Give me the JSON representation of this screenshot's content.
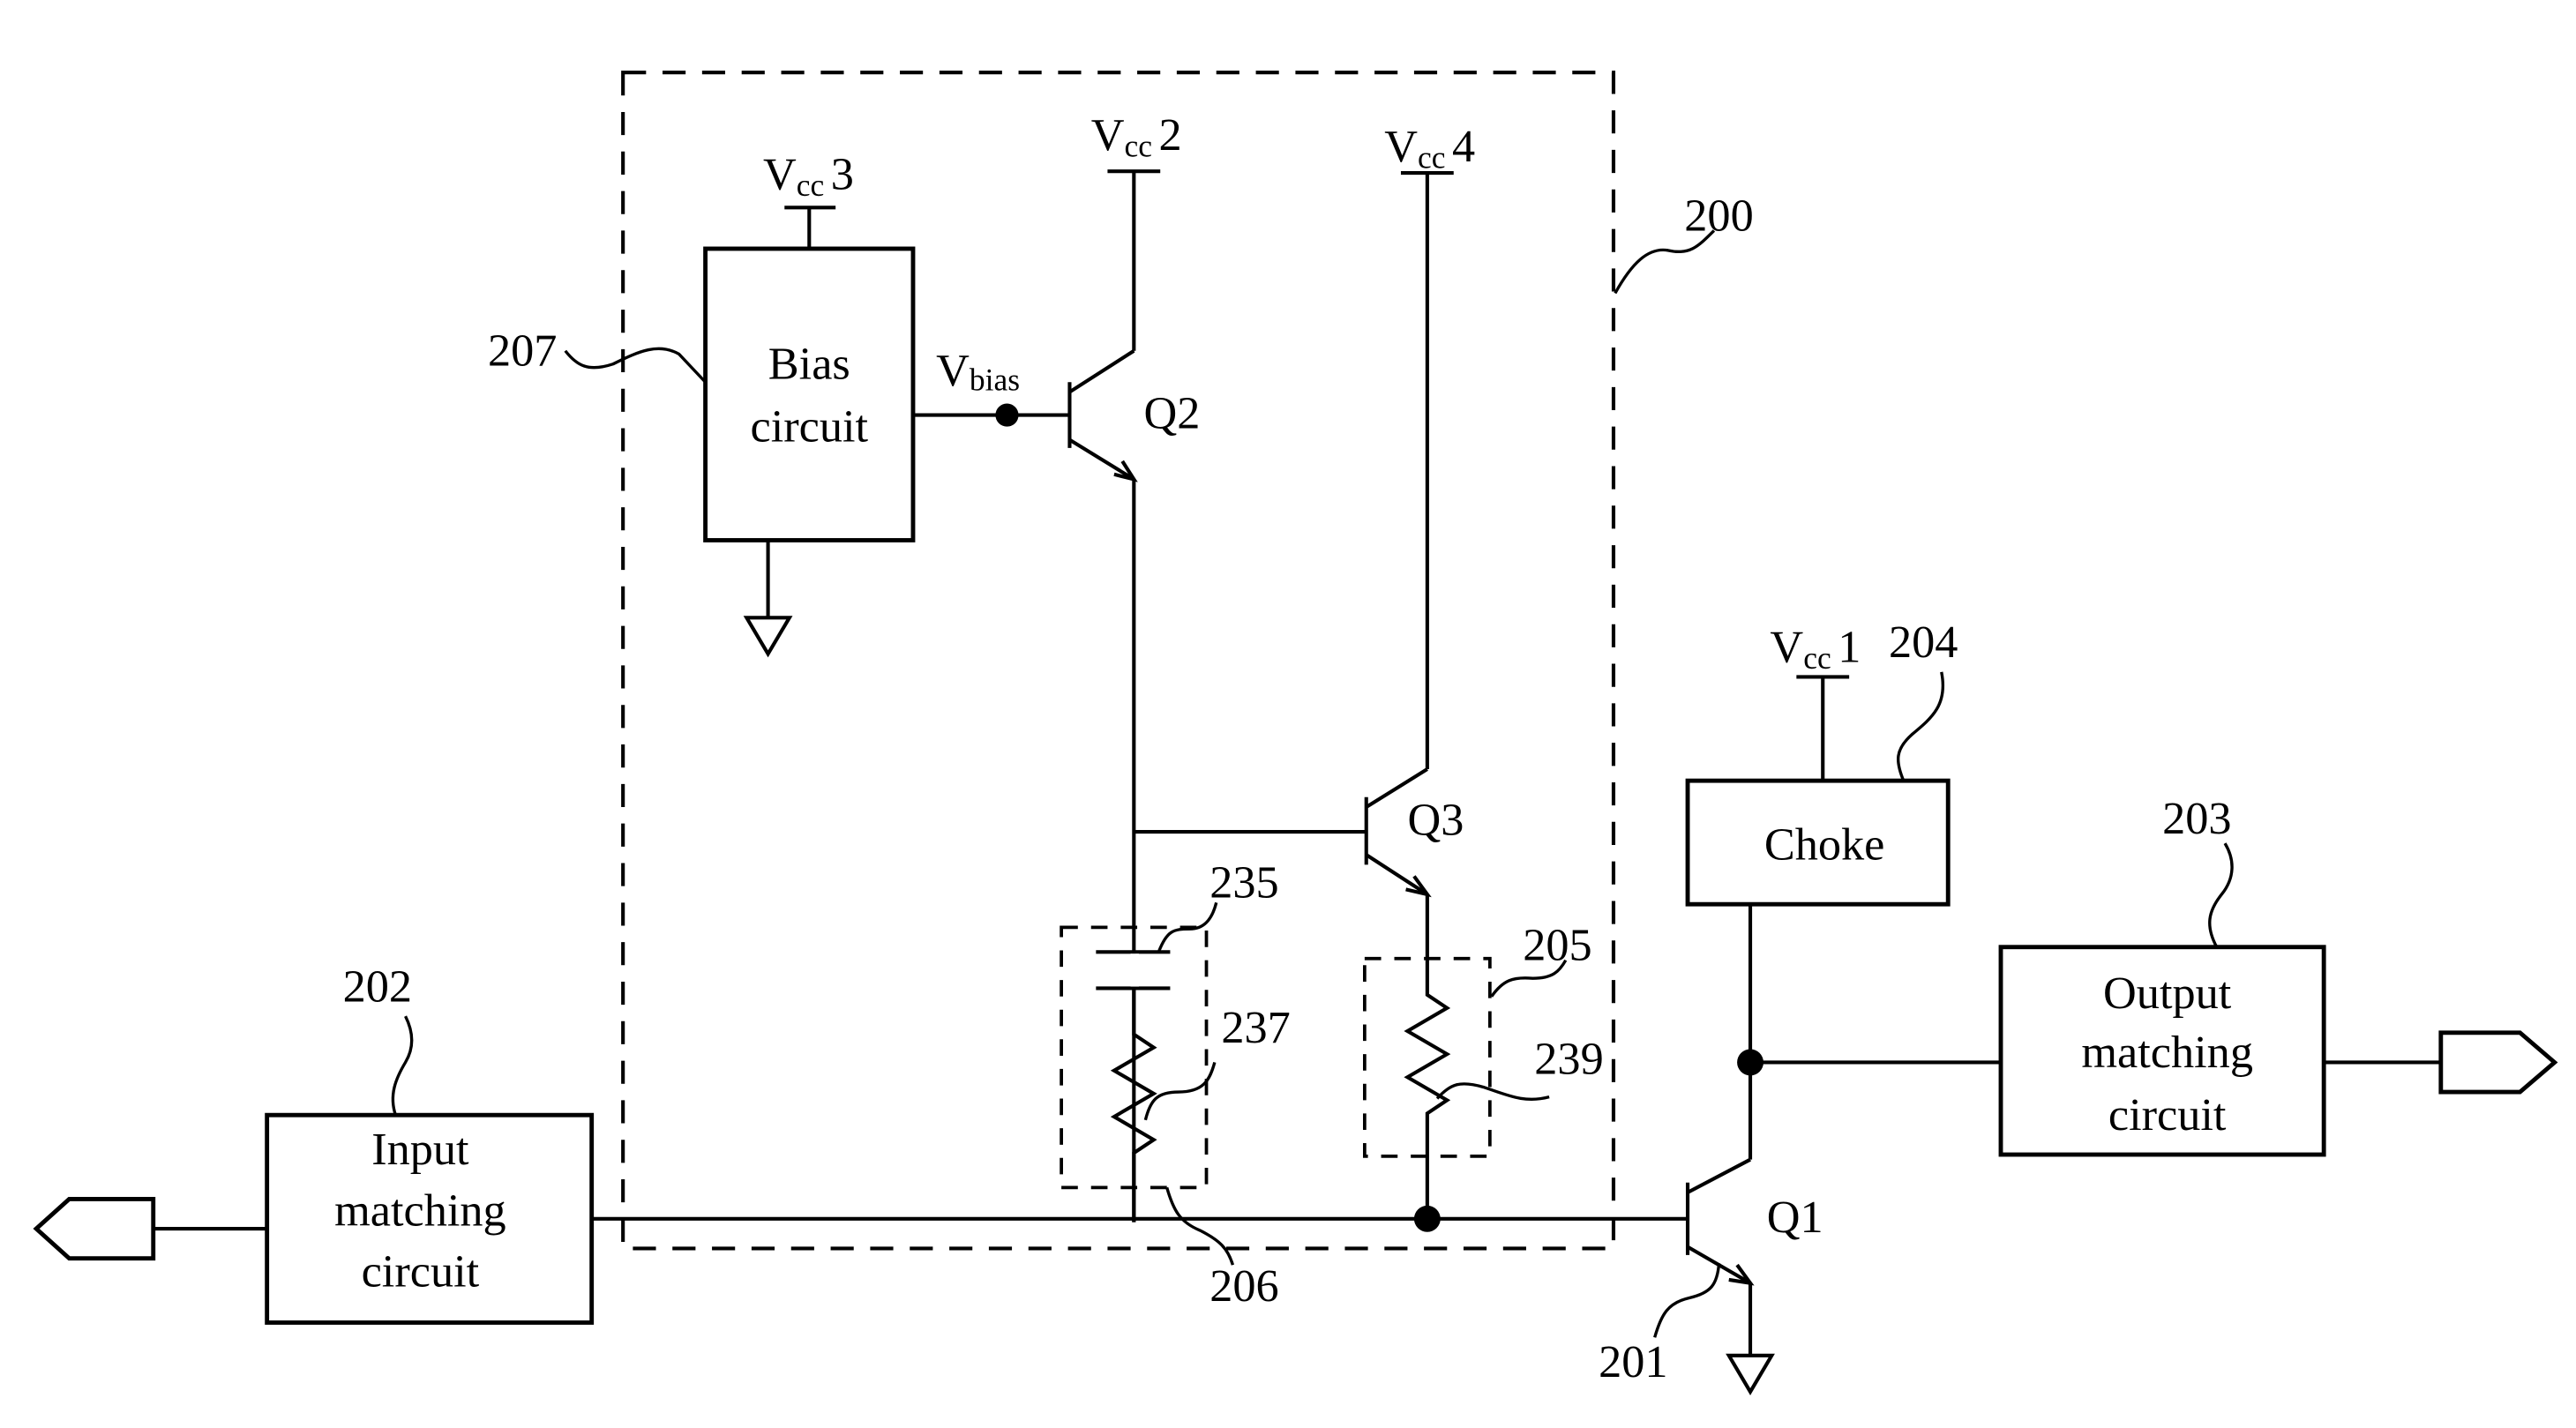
{
  "diagram": {
    "blocks": {
      "bias": {
        "line1": "Bias",
        "line2": "circuit",
        "ref": "207"
      },
      "input": {
        "line1": "Input",
        "line2": "matching",
        "line3": "circuit",
        "ref": "202"
      },
      "output": {
        "line1": "Output",
        "line2": "matching",
        "line3": "circuit",
        "ref": "203"
      },
      "choke": {
        "label": "Choke",
        "ref": "204"
      }
    },
    "supplies": {
      "vcc1": {
        "main": "V",
        "sub": "cc",
        "num": "1"
      },
      "vcc2": {
        "main": "V",
        "sub": "cc",
        "num": "2"
      },
      "vcc3": {
        "main": "V",
        "sub": "cc",
        "num": "3"
      },
      "vcc4": {
        "main": "V",
        "sub": "cc",
        "num": "4"
      }
    },
    "vbias": {
      "main": "V",
      "sub": "bias"
    },
    "transistors": {
      "q1": "Q1",
      "q2": "Q2",
      "q3": "Q3"
    },
    "refs": {
      "r200": "200",
      "r201": "201",
      "r205": "205",
      "r206": "206",
      "r235": "235",
      "r237": "237",
      "r239": "239"
    }
  }
}
